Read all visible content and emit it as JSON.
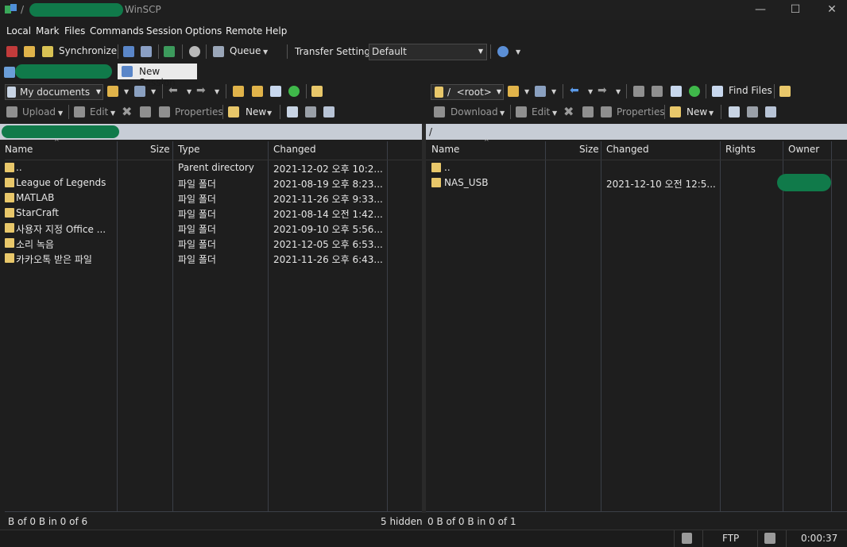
{
  "window": {
    "title_prefix": "/",
    "title_app": "WinSCP",
    "minimize": "—",
    "maximize": "☐",
    "close": "✕"
  },
  "menu": [
    "Local",
    "Mark",
    "Files",
    "Commands",
    "Session",
    "Options",
    "Remote",
    "Help"
  ],
  "toolbar": {
    "synchronize": "Synchronize",
    "queue": "Queue",
    "transfer_settings_label": "Transfer Settings",
    "transfer_settings_value": "Default"
  },
  "session_tab": {
    "new_session": "New Session"
  },
  "left": {
    "location": "My documents",
    "upload": "Upload",
    "edit": "Edit",
    "properties": "Properties",
    "new": "New",
    "columns": [
      "Name",
      "Size",
      "Type",
      "Changed"
    ],
    "rows": [
      {
        "name": "..",
        "type": "Parent directory",
        "changed": "2021-12-02  오후 10:2..."
      },
      {
        "name": "League of Legends",
        "type": "파일 폴더",
        "changed": "2021-08-19  오후 8:23..."
      },
      {
        "name": "MATLAB",
        "type": "파일 폴더",
        "changed": "2021-11-26  오후 9:33..."
      },
      {
        "name": "StarCraft",
        "type": "파일 폴더",
        "changed": "2021-08-14  오전 1:42..."
      },
      {
        "name": "사용자 지정 Office ...",
        "type": "파일 폴더",
        "changed": "2021-09-10  오후 5:56..."
      },
      {
        "name": "소리 녹음",
        "type": "파일 폴더",
        "changed": "2021-12-05  오후 6:53..."
      },
      {
        "name": "카카오톡 받은 파일",
        "type": "파일 폴더",
        "changed": "2021-11-26  오후 6:43..."
      }
    ],
    "status": "B of 0 B in 0 of 6",
    "hidden": "5 hidden"
  },
  "right": {
    "location": "/  <root>",
    "find_files": "Find Files",
    "download": "Download",
    "edit": "Edit",
    "properties": "Properties",
    "new": "New",
    "path": "/",
    "columns": [
      "Name",
      "Size",
      "Changed",
      "Rights",
      "Owner"
    ],
    "rows": [
      {
        "name": "..",
        "changed": ""
      },
      {
        "name": "NAS_USB",
        "changed": "2021-12-10  오전 12:5..."
      }
    ],
    "status": "0 B of 0 B in 0 of 1"
  },
  "bottom": {
    "protocol": "FTP",
    "timer": "0:00:37"
  },
  "colors": {
    "folder": "#e8c76a",
    "path_bar": "#c7cdd6",
    "redaction": "#107a4a"
  }
}
